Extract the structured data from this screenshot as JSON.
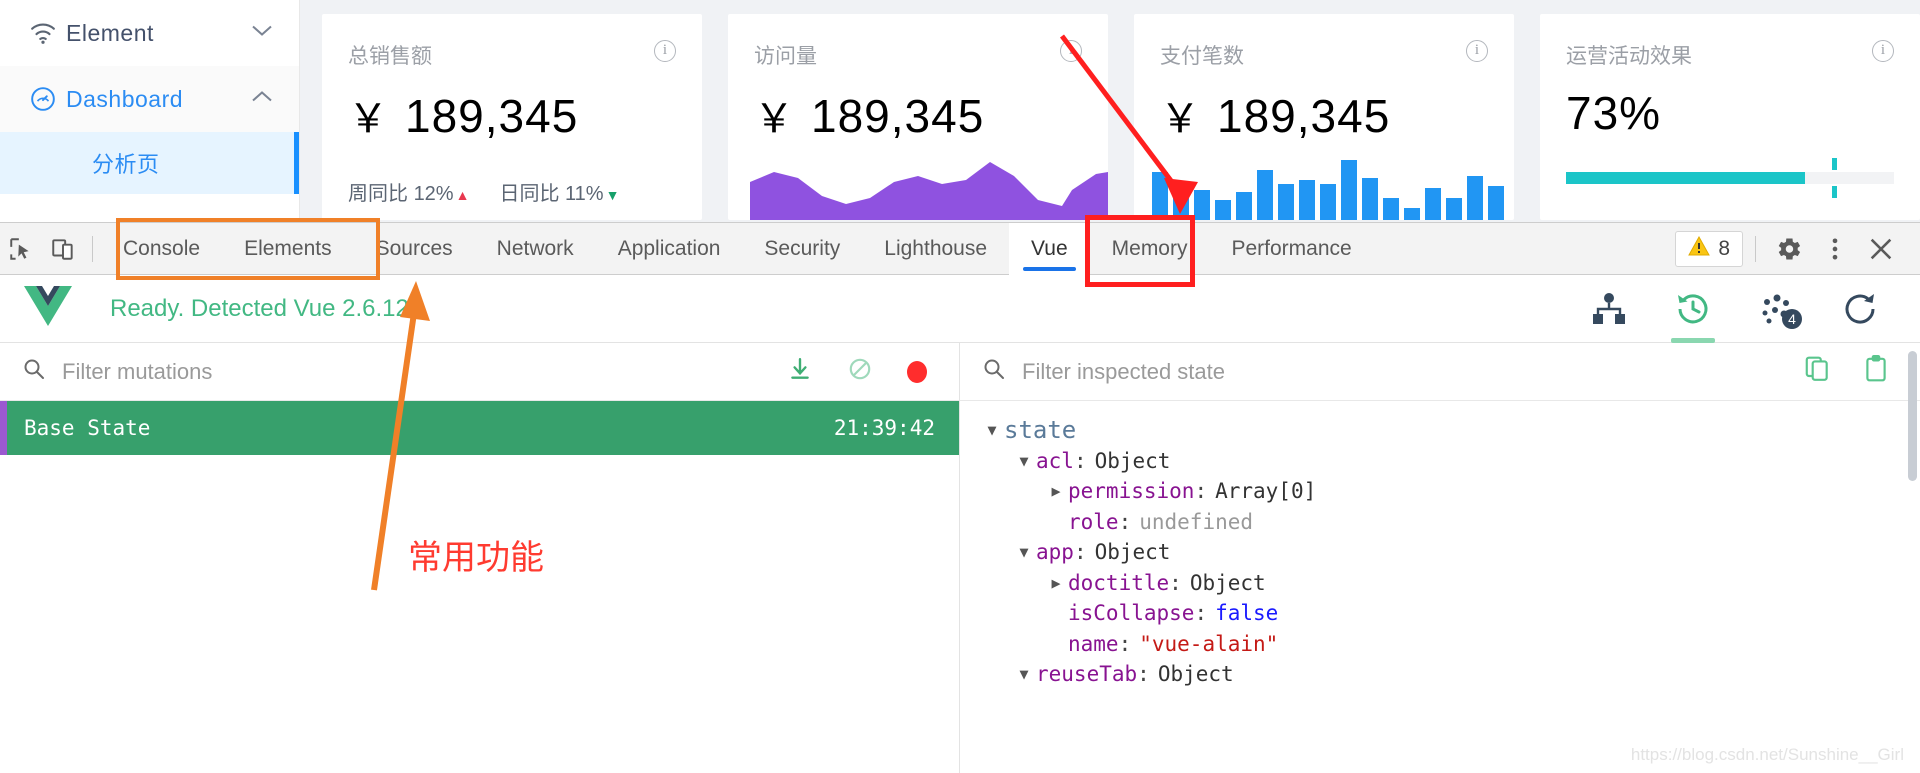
{
  "app": {
    "sidebar": {
      "logo_label": "Element",
      "items": [
        {
          "label": "Dashboard",
          "icon": "dashboard-icon"
        },
        {
          "label": "分析页",
          "icon": "none"
        }
      ]
    },
    "cards": [
      {
        "title": "总销售额",
        "currency": "￥",
        "value": "189,345",
        "info_icon": "info-icon",
        "footer": [
          {
            "label": "周同比",
            "value": "12%",
            "trend": "up"
          },
          {
            "label": "日同比",
            "value": "11%",
            "trend": "down"
          }
        ],
        "visual": "none"
      },
      {
        "title": "访问量",
        "currency": "￥",
        "value": "189,345",
        "info_icon": "info-icon",
        "visual": "area-chart",
        "visual_color": "#8f52e0"
      },
      {
        "title": "支付笔数",
        "currency": "￥",
        "value": "189,345",
        "info_icon": "info-icon",
        "visual": "bar-chart",
        "visual_color": "#2196f3"
      },
      {
        "title": "运营活动效果",
        "currency": "",
        "value": "73%",
        "info_icon": "info-icon",
        "visual": "progress",
        "visual_color": "#1bc5c8",
        "progress_percent": 73
      }
    ]
  },
  "devtools": {
    "left_icons": [
      "inspect-element-icon",
      "device-toolbar-icon"
    ],
    "tabs": [
      {
        "label": "Console",
        "active": false
      },
      {
        "label": "Elements",
        "active": false
      },
      {
        "label": "Sources",
        "active": false
      },
      {
        "label": "Network",
        "active": false
      },
      {
        "label": "Application",
        "active": false
      },
      {
        "label": "Security",
        "active": false
      },
      {
        "label": "Lighthouse",
        "active": false
      },
      {
        "label": "Vue",
        "active": true
      },
      {
        "label": "Memory",
        "active": false
      },
      {
        "label": "Performance",
        "active": false
      }
    ],
    "warning_count": "8",
    "warning_icon": "warning-triangle-icon",
    "settings_icon": "gear-icon",
    "more_icon": "kebab-menu-icon",
    "close_icon": "close-icon"
  },
  "vue_panel": {
    "logo_icon": "vue-logo-icon",
    "status_message": "Ready. Detected Vue 2.6.12.",
    "actions": [
      {
        "name": "components-tree-icon",
        "active": false,
        "badge": ""
      },
      {
        "name": "vuex-history-icon",
        "active": true,
        "badge": ""
      },
      {
        "name": "events-icon",
        "active": false,
        "badge": "4"
      },
      {
        "name": "refresh-icon",
        "active": false,
        "badge": ""
      }
    ]
  },
  "mutations_pane": {
    "search_icon": "search-icon",
    "filter_placeholder": "Filter mutations",
    "filter_value": "",
    "actions": [
      {
        "name": "export-icon"
      },
      {
        "name": "clear-icon"
      },
      {
        "name": "record-icon"
      }
    ],
    "entries": [
      {
        "name": "Base State",
        "time": "21:39:42",
        "selected": true
      }
    ]
  },
  "state_pane": {
    "search_icon": "search-icon",
    "filter_placeholder": "Filter inspected state",
    "filter_value": "",
    "actions": [
      {
        "name": "copy-icon"
      },
      {
        "name": "clipboard-icon"
      }
    ],
    "tree": [
      {
        "indent": 0,
        "toggle": "expanded",
        "key": "state",
        "colon": "",
        "value": "",
        "value_type": "root"
      },
      {
        "indent": 1,
        "toggle": "expanded",
        "key": "acl",
        "colon": ":",
        "value": "Object",
        "value_type": "plain"
      },
      {
        "indent": 2,
        "toggle": "collapsed",
        "key": "permission",
        "colon": ":",
        "value": "Array[0]",
        "value_type": "plain"
      },
      {
        "indent": 2,
        "toggle": "none",
        "key": "role",
        "colon": ":",
        "value": "undefined",
        "value_type": "undef"
      },
      {
        "indent": 1,
        "toggle": "expanded",
        "key": "app",
        "colon": ":",
        "value": "Object",
        "value_type": "plain"
      },
      {
        "indent": 2,
        "toggle": "collapsed",
        "key": "doctitle",
        "colon": ":",
        "value": "Object",
        "value_type": "plain"
      },
      {
        "indent": 2,
        "toggle": "none",
        "key": "isCollapse",
        "colon": ":",
        "value": "false",
        "value_type": "bool"
      },
      {
        "indent": 2,
        "toggle": "none",
        "key": "name",
        "colon": ":",
        "value": "\"vue-alain\"",
        "value_type": "str"
      },
      {
        "indent": 1,
        "toggle": "expanded",
        "key": "reuseTab",
        "colon": ":",
        "value": "Object",
        "value_type": "plain"
      }
    ]
  },
  "annotations": {
    "common_features_label": "常用功能",
    "orange_box_target": "console-elements-tabs",
    "red_box_target": "vue-tab",
    "red_arrow_target": "vue-tab"
  },
  "watermark": "https://blog.csdn.net/Sunshine__Girl",
  "colors": {
    "accent_blue": "#1890ff",
    "vue_green": "#42b883",
    "mutation_green": "#37a06c",
    "annotation_orange": "#f08028",
    "annotation_red": "#ff1f1f",
    "progress_teal": "#1bc5c8",
    "spark_purple": "#8f52e0",
    "bar_blue": "#2196f3"
  }
}
